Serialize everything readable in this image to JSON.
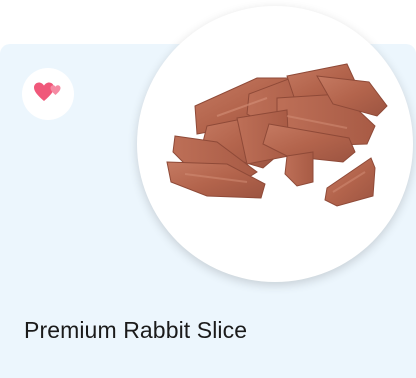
{
  "product": {
    "title": "Premium Rabbit Slice",
    "image": {
      "icon": "rabbit-jerky-slices-photo"
    },
    "favorite": {
      "icon": "hearts-icon",
      "color": "#f0587a"
    }
  },
  "card": {
    "background": "#ecf6fd"
  }
}
